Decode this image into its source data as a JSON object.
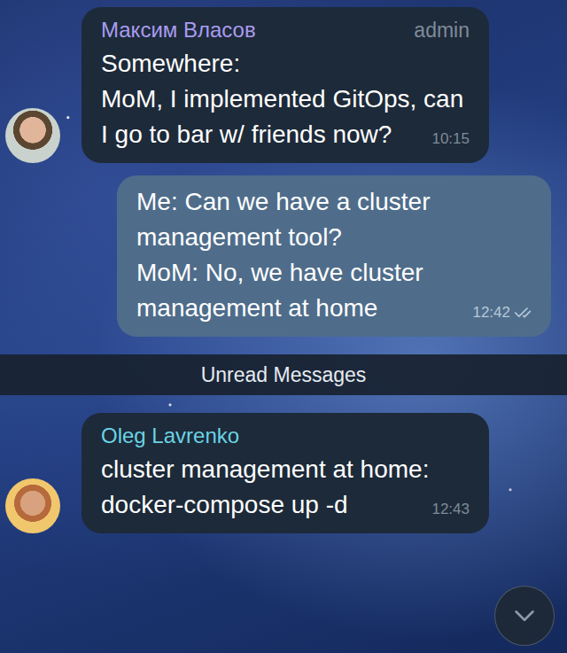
{
  "chat": {
    "messages": [
      {
        "kind": "incoming",
        "author": "Максим Власов",
        "role": "admin",
        "text": "Somewhere:\nMoM, I implemented GitOps, can I go to bar w/ friends now?",
        "time": "10:15",
        "color": "#a99cf0"
      },
      {
        "kind": "outgoing",
        "text": "Me: Can we have a cluster management tool?\nMoM: No, we have cluster management at home",
        "time": "12:42",
        "read": true
      },
      {
        "kind": "divider",
        "text": "Unread Messages"
      },
      {
        "kind": "incoming",
        "author": "Oleg Lavrenko",
        "text": "cluster management at home: docker-compose up -d",
        "time": "12:43",
        "color": "#6ad3e4"
      }
    ]
  }
}
